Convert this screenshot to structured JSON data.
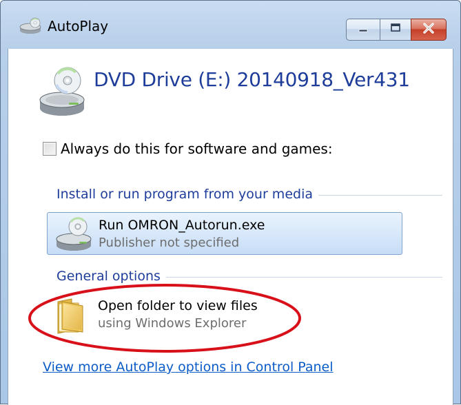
{
  "window": {
    "title": "AutoPlay"
  },
  "drive": {
    "title": "DVD Drive (E:) 20140918_Ver431"
  },
  "always_checkbox": {
    "label": "Always do this for software and games:",
    "checked": false
  },
  "sections": {
    "install": {
      "header": "Install or run program from your media",
      "option_title": "Run OMRON_Autorun.exe",
      "option_subtitle": "Publisher not specified"
    },
    "general": {
      "header": "General options",
      "option_title": "Open folder to view files",
      "option_subtitle": "using Windows Explorer"
    }
  },
  "more_link": "View more AutoPlay options in Control Panel",
  "colors": {
    "heading_blue": "#1e3d9a",
    "link_blue": "#0b5cc9",
    "annotation_red": "#d8101a",
    "close_red": "#c4402a"
  },
  "icons": {
    "title": "autoplay-drive-icon",
    "drive": "dvd-drive-icon",
    "option": "dvd-drive-icon",
    "folder": "folder-icon",
    "minimize": "minimize-icon",
    "maximize": "maximize-icon",
    "close": "close-icon"
  }
}
